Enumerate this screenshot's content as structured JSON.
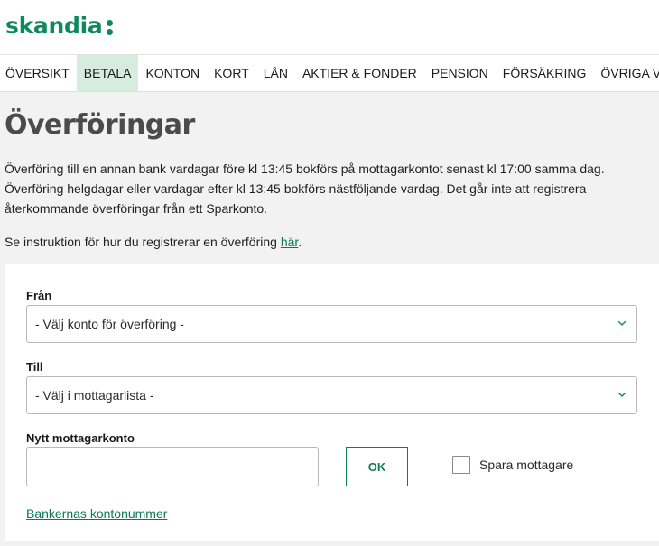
{
  "brand": {
    "name": "skandia",
    "color": "#0c8a5e"
  },
  "nav": {
    "items": [
      {
        "label": "ÖVERSIKT"
      },
      {
        "label": "BETALA"
      },
      {
        "label": "KONTON"
      },
      {
        "label": "KORT"
      },
      {
        "label": "LÅN"
      },
      {
        "label": "AKTIER & FONDER"
      },
      {
        "label": "PENSION"
      },
      {
        "label": "FÖRSÄKRING"
      },
      {
        "label": "ÖVRIGA VAL"
      }
    ],
    "active": "BETALA"
  },
  "page": {
    "title": "Överföringar",
    "intro_line1": "Överföring till en annan bank vardagar före kl 13:45 bokförs på mottagarkontot senast kl 17:00 samma dag.",
    "intro_line2": "Överföring helgdagar eller vardagar efter kl 13:45 bokförs nästföljande vardag. Det går inte att registrera återkommande överföringar från ett Sparkonto.",
    "instruction_text": "Se instruktion för hur du registrerar en överföring ",
    "instruction_link": "här",
    "instruction_end": "."
  },
  "form": {
    "from_label": "Från",
    "from_value": "- Välj konto för överföring -",
    "to_label": "Till",
    "to_value": "- Välj i mottagarlista -",
    "new_account_label": "Nytt mottagarkonto",
    "new_account_value": "",
    "ok_label": "OK",
    "save_label": "Spara mottagare",
    "save_checked": false,
    "banks_link": "Bankernas kontonummer"
  },
  "icons": {
    "select_arrow": "chevron-down-icon"
  },
  "colors": {
    "accent": "#0c8a5e",
    "nav_active_bg": "#d5ecdf",
    "link": "#0b7a52"
  }
}
